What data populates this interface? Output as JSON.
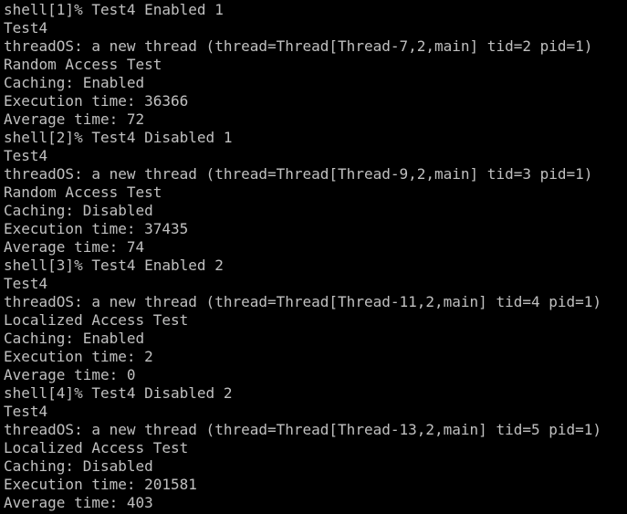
{
  "terminal": {
    "text_color": "#c0c0c0",
    "background_color": "#000000",
    "lines": [
      "shell[1]% Test4 Enabled 1",
      "Test4",
      "threadOS: a new thread (thread=Thread[Thread-7,2,main] tid=2 pid=1)",
      "Random Access Test",
      "Caching: Enabled",
      "Execution time: 36366",
      "Average time: 72",
      "shell[2]% Test4 Disabled 1",
      "Test4",
      "threadOS: a new thread (thread=Thread[Thread-9,2,main] tid=3 pid=1)",
      "Random Access Test",
      "Caching: Disabled",
      "Execution time: 37435",
      "Average time: 74",
      "shell[3]% Test4 Enabled 2",
      "Test4",
      "threadOS: a new thread (thread=Thread[Thread-11,2,main] tid=4 pid=1)",
      "Localized Access Test",
      "Caching: Enabled",
      "Execution time: 2",
      "Average time: 0",
      "shell[4]% Test4 Disabled 2",
      "Test4",
      "threadOS: a new thread (thread=Thread[Thread-13,2,main] tid=5 pid=1)",
      "Localized Access Test",
      "Caching: Disabled",
      "Execution time: 201581",
      "Average time: 403"
    ]
  }
}
